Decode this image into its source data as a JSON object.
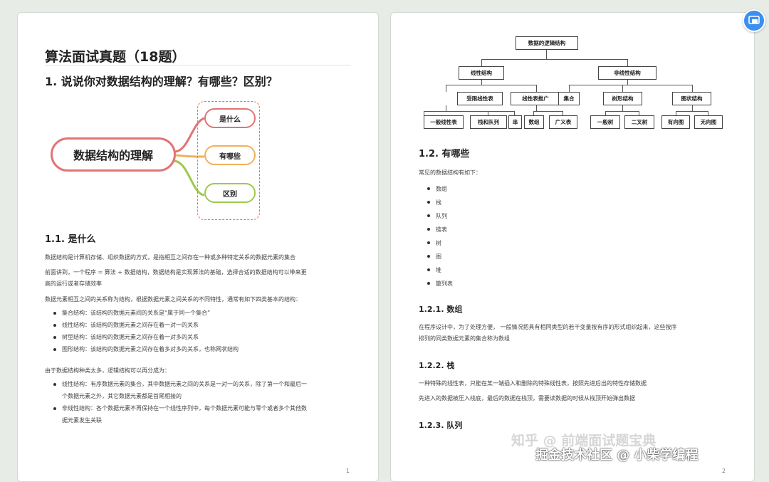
{
  "page1": {
    "doc_title": "算法面试真题（18题）",
    "h1": "1. 说说你对数据结构的理解？有哪些？区别？",
    "mindmap": {
      "center": "数据结构的理解",
      "nodes": [
        "是什么",
        "有哪些",
        "区别"
      ]
    },
    "sec_1_1": "1.1. 是什么",
    "p1": "数据结构是计算机存储、组织数据的方式，是指相互之间存在一种或多种特定关系的数据元素的集合",
    "p2a": "前面讲到，一个程序 = 算法 + 数据结构，数据结构是实现算法的基础，选择合适的数据结构可以带来更",
    "p2b": "高的运行或者存储效率",
    "p3": "数据元素相互之间的关系称为结构，根据数据元素之间关系的不同特性，通常有如下四类基本的结构：",
    "list1": [
      "集合结构：该结构的数据元素间的关系是“属于同一个集合”",
      "线性结构：该结构的数据元素之间存在着一对一的关系",
      "树型结构：该结构的数据元素之间存在着一对多的关系",
      "图形结构：该结构的数据元素之间存在着多对多的关系，也称网状结构"
    ],
    "p4": "由于数据结构种类太多，逻辑结构可以再分成为：",
    "list2a1": "线性结构：有序数据元素的集合，其中数据元素之间的关系是一对一的关系，除了第一个和最后一",
    "list2a2": "个数据元素之外，其它数据元素都是首尾相接的",
    "list2b1": "非线性结构：各个数据元素不再保持在一个线性序列中，每个数据元素可能与零个或者多个其他数",
    "list2b2": "据元素发生关联",
    "page_number": "1"
  },
  "page2": {
    "tree": {
      "root": "数据的逻辑结构",
      "l1": [
        "线性结构",
        "非线性结构"
      ],
      "l2": [
        "受限线性表",
        "线性表推广",
        "集合",
        "树形结构",
        "图状结构"
      ],
      "l3": [
        "一般线性表",
        "栈和队列",
        "串",
        "数组",
        "广义表",
        "一般树",
        "二叉树",
        "有向图",
        "无向图"
      ]
    },
    "sec_1_2": "1.2. 有哪些",
    "p_intro": "常见的数据结构有如下：",
    "list": [
      "数组",
      "栈",
      "队列",
      "链表",
      "树",
      "图",
      "堆",
      "散列表"
    ],
    "sec_1_2_1": "1.2.1. 数组",
    "p_arr1": "在程序设计中，为了处理方便， 一般情况把具有相同类型的若干变量按有序的形式组织起来，这些按序",
    "p_arr2": "排列的同类数据元素的集合称为数组",
    "sec_1_2_2": "1.2.2. 栈",
    "p_stack1": "一种特殊的线性表，只能在某一端插入和删除的特殊线性表，按照先进后出的特性存储数据",
    "p_stack2": "先进入的数据被压入栈底，最后的数据在栈顶，需要读数据的时候从栈顶开始弹出数据",
    "sec_1_2_3": "1.2.3. 队列",
    "page_number": "2"
  },
  "watermark": "掘金技术社区 @ 小柴学编程",
  "watermark_faint": "知乎 @ 前端面试题宝典",
  "colors": {
    "mind_red": "#e07575",
    "mind_orange": "#efb25a",
    "mind_green": "#9fc94e",
    "badge_blue": "#3a8ff0"
  },
  "icons": {
    "badge": "cast-icon"
  }
}
